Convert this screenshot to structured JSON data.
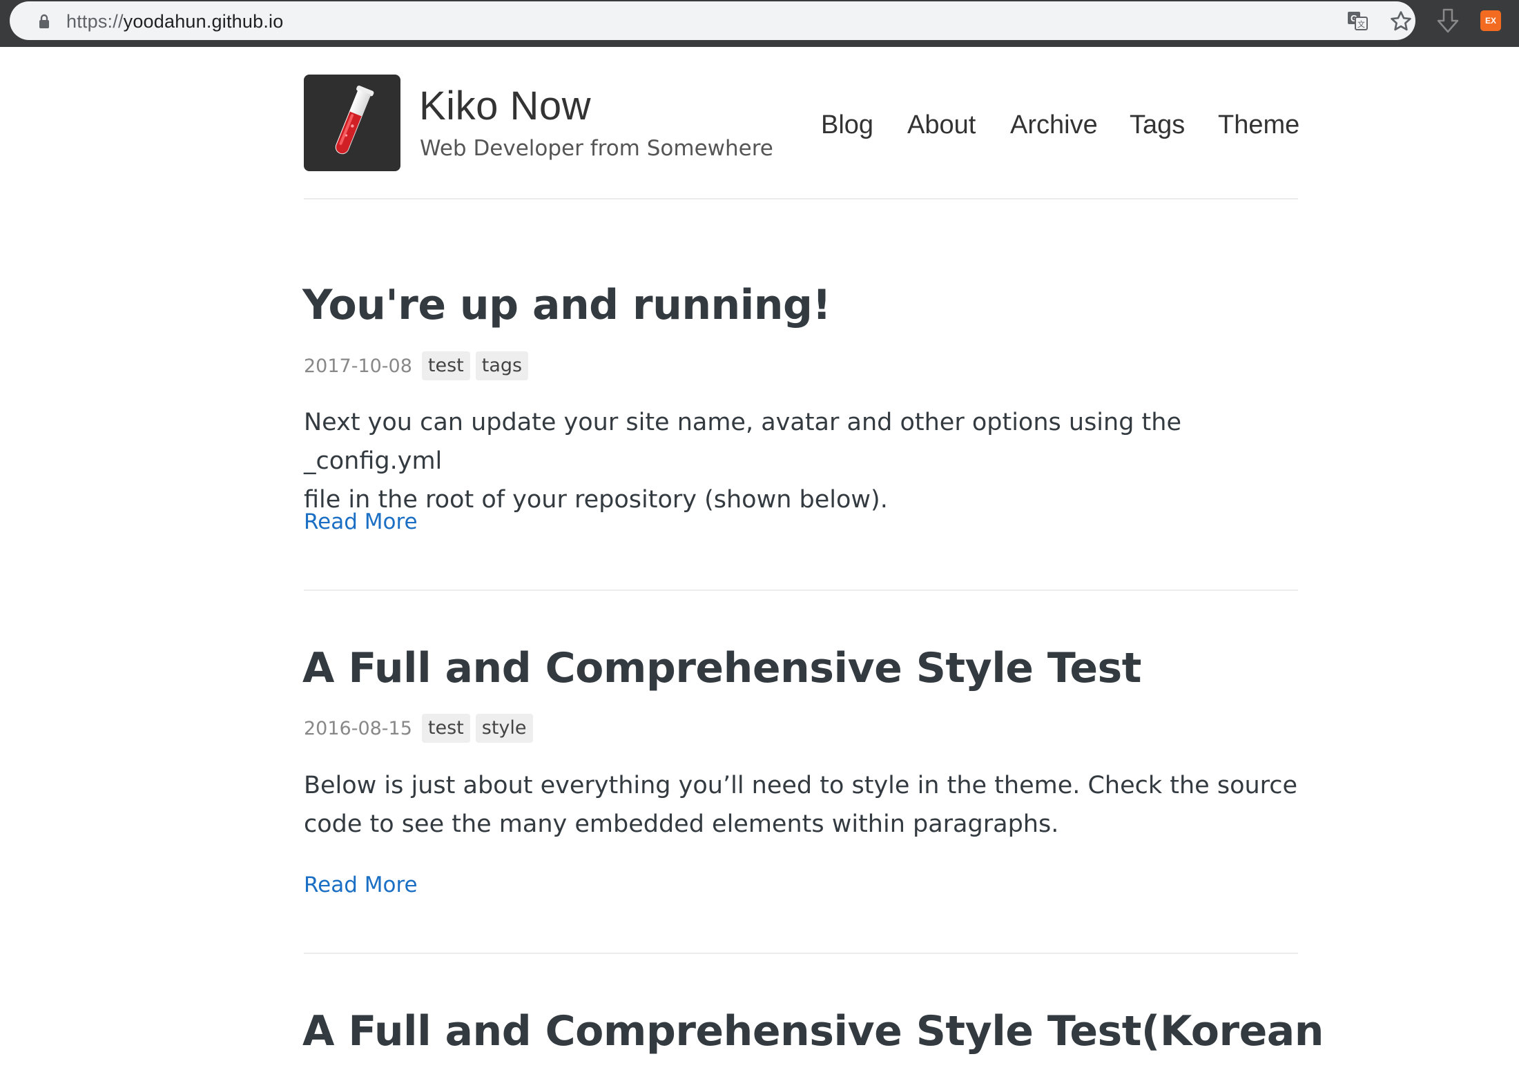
{
  "browser": {
    "url_scheme": "https://",
    "url_host": "yoodahun.github.io",
    "extension_label": "EX"
  },
  "site": {
    "title": "Kiko Now",
    "subtitle": "Web Developer from Somewhere"
  },
  "nav": {
    "items": [
      {
        "label": "Blog"
      },
      {
        "label": "About"
      },
      {
        "label": "Archive"
      },
      {
        "label": "Tags"
      },
      {
        "label": "Theme"
      }
    ]
  },
  "posts": [
    {
      "title": "You're up and running!",
      "date": "2017-10-08",
      "tags": [
        "test",
        "tags"
      ],
      "excerpt_line1": "Next you can update your site name, avatar and other options using the _config.yml",
      "excerpt_line2": "file in the root of your repository (shown below).",
      "read_more": "Read More"
    },
    {
      "title": "A Full and Comprehensive Style Test",
      "date": "2016-08-15",
      "tags": [
        "test",
        "style"
      ],
      "excerpt_line1": "Below is just about everything you’ll need to style in the theme. Check the source",
      "excerpt_line2": "code to see the many embedded elements within paragraphs.",
      "read_more": "Read More"
    },
    {
      "title": "A Full and Comprehensive Style Test(Korean"
    }
  ],
  "colors": {
    "link": "#1a6fc4",
    "text": "#333a40",
    "chrome": "#3a3b3d",
    "extension": "#f26b21"
  }
}
